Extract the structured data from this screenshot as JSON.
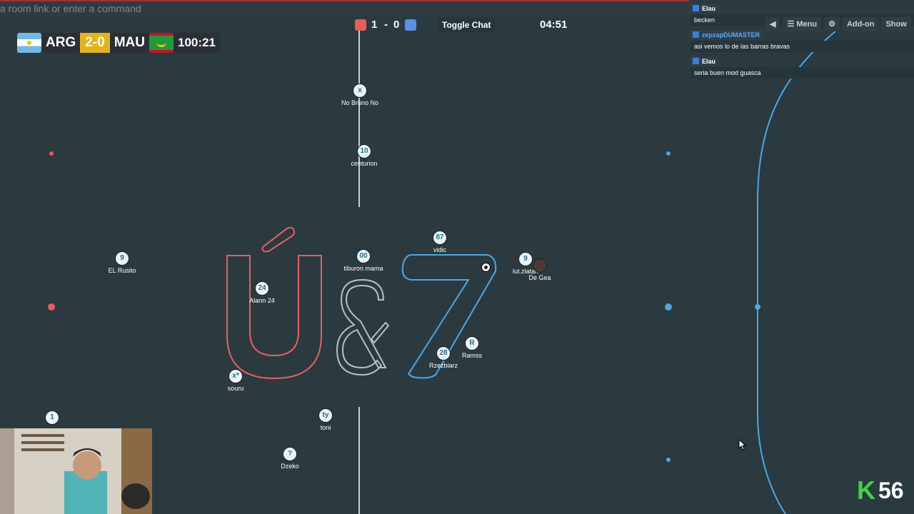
{
  "command_bar": {
    "placeholder": "a room link or enter a command"
  },
  "scoreboard": {
    "red_score": "1",
    "separator": "-",
    "blue_score": "0",
    "toggle_chat_label": "Toggle Chat",
    "time": "04:51",
    "red_color": "#e85c5c",
    "blue_color": "#5d8fe6"
  },
  "tv_score": {
    "home": "ARG",
    "result": "2-0",
    "away": "MAU",
    "time": "100:21"
  },
  "chat": [
    {
      "user": "Elau",
      "text": "becken",
      "user_color": "#ffffff"
    },
    {
      "user": "zepzapDUMASTER",
      "text": "asi vemos lo de las barras bravas",
      "user_color": "#5aa8ff"
    },
    {
      "user": "Elau",
      "text": "seria buen mod guasca",
      "user_color": "#ffffff"
    }
  ],
  "top_buttons": [
    "◀",
    "☰ Menu",
    "⚙",
    "Add-on",
    "Show"
  ],
  "players": [
    {
      "avatar": "x",
      "name": "No Bruno No"
    },
    {
      "avatar": "10",
      "name": "centurion"
    },
    {
      "avatar": "9",
      "name": "EL Rusito"
    },
    {
      "avatar": "00",
      "name": "tiburon mama"
    },
    {
      "avatar": "87",
      "name": "vidic"
    },
    {
      "avatar": "9",
      "name": "lut.zlatan"
    },
    {
      "avatar": "",
      "name": "De Gea"
    },
    {
      "avatar": "24",
      "name": "Alann 24"
    },
    {
      "avatar": "28",
      "name": "Rzezbiarz"
    },
    {
      "avatar": "R",
      "name": "Ramss"
    },
    {
      "avatar": "x*",
      "name": "souru"
    },
    {
      "avatar": "ty",
      "name": "toni"
    },
    {
      "avatar": "?",
      "name": "Dzeko"
    },
    {
      "avatar": "1",
      "name": ""
    }
  ],
  "logo_text": "Ú&7",
  "k_badge": {
    "letter": "K",
    "number": "56"
  }
}
